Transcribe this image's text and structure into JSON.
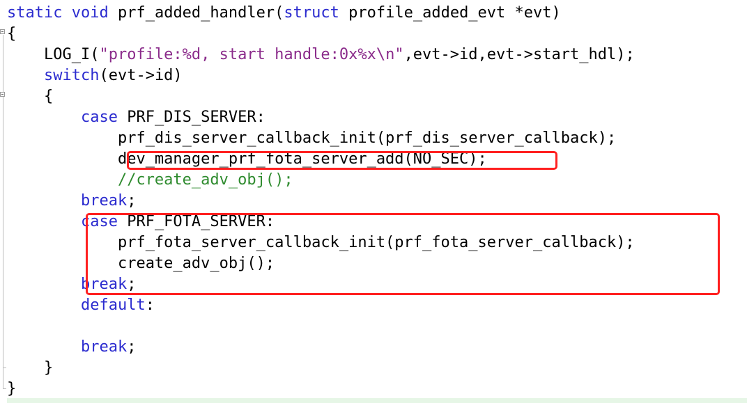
{
  "code": {
    "l1": {
      "kw1": "static",
      "kw2": "void",
      "name": "prf_added_handler(",
      "kw3": "struct",
      "rest": "profile_added_evt *evt)"
    },
    "l2": "{",
    "l3": {
      "call": "LOG_I(",
      "str": "\"profile:%d, start handle:0x%x\\n\"",
      "rest": ",evt->id,evt->start_hdl);"
    },
    "l4": {
      "kw": "switch",
      "rest": "(evt->id)"
    },
    "l5": "{",
    "l6": {
      "kw": "case",
      "rest": "PRF_DIS_SERVER:"
    },
    "l7": "prf_dis_server_callback_init(prf_dis_server_callback);",
    "l8": "dev_manager_prf_fota_server_add(NO_SEC);",
    "l9": "//create_adv_obj();",
    "l10": {
      "kw": "break",
      "rest": ";"
    },
    "l11": {
      "kw": "case",
      "rest": "PRF_FOTA_SERVER:"
    },
    "l12": "prf_fota_server_callback_init(prf_fota_server_callback);",
    "l13": "create_adv_obj();",
    "l14": {
      "kw": "break",
      "rest": ";"
    },
    "l15": {
      "kw": "default",
      "rest": ":"
    },
    "l16": {
      "kw": "break",
      "rest": ";"
    },
    "l17": "}",
    "l18": "}"
  },
  "colors": {
    "keyword": "#2b2bcf",
    "string": "#8b2c8b",
    "comment": "#2e8b2e",
    "highlight_border": "#ff2020"
  }
}
